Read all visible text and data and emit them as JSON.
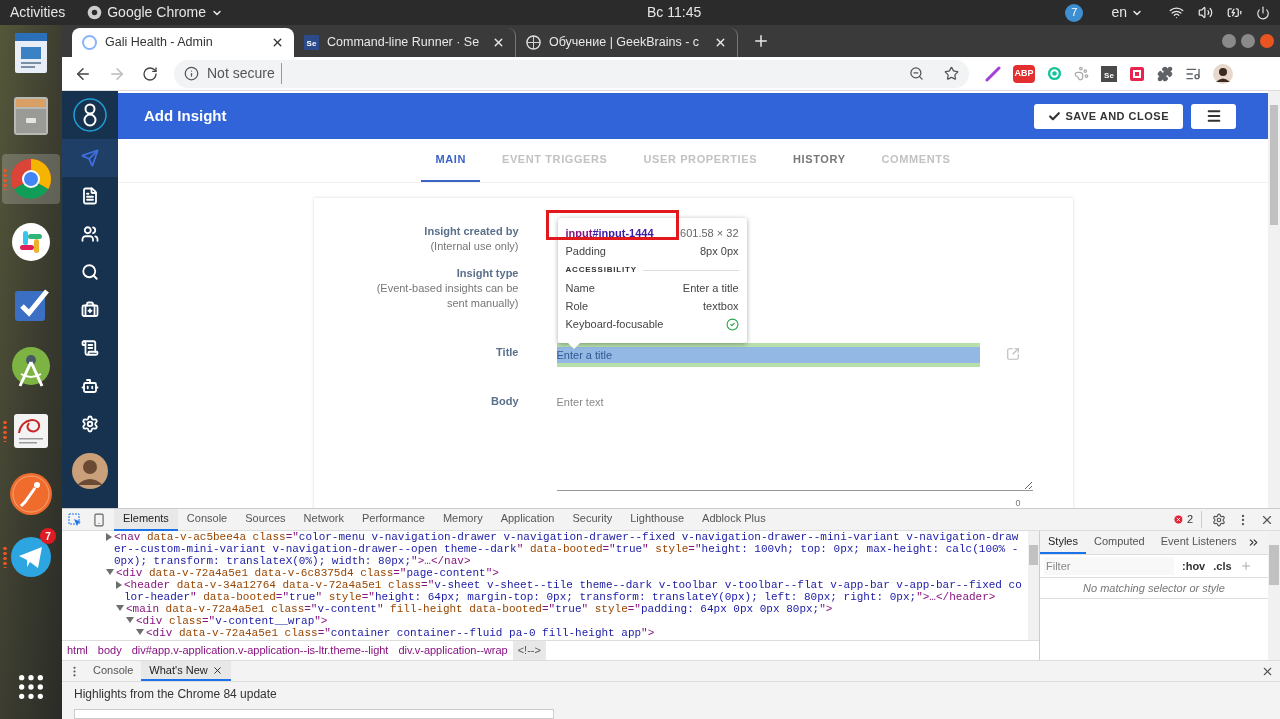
{
  "system_bar": {
    "activities": "Activities",
    "app_menu": "Google Chrome",
    "clock": "Вс 11:45",
    "notification_count": "7",
    "language": "en"
  },
  "dock": [
    {
      "selected": false,
      "running": false
    },
    {
      "selected": false,
      "running": false
    },
    {
      "selected": true,
      "running": true
    },
    {
      "selected": false,
      "running": false
    },
    {
      "selected": false,
      "running": false
    },
    {
      "selected": false,
      "running": false
    },
    {
      "selected": false,
      "running": true
    },
    {
      "selected": false,
      "running": false
    },
    {
      "selected": false,
      "running": true,
      "badge": "7"
    }
  ],
  "browser": {
    "tabs": [
      {
        "title": "Gali Health - Admin",
        "selected": true
      },
      {
        "title": "Command-line Runner · Se",
        "favicon_text": "Se",
        "selected": false
      },
      {
        "title": "Обучение | GeekBrains - c",
        "selected": false
      }
    ],
    "nav_buttons": [
      {
        "kind": "back",
        "disabled": false
      },
      {
        "kind": "forward",
        "disabled": true
      },
      {
        "kind": "reload",
        "disabled": false
      }
    ],
    "security_label": "Not secure",
    "extensions": [
      {
        "kind": "pen"
      },
      {
        "kind": "abp",
        "text": "ABP"
      },
      {
        "kind": "ring"
      },
      {
        "kind": "paw"
      },
      {
        "kind": "tile",
        "text": "Se"
      },
      {
        "kind": "frame"
      },
      {
        "kind": "puzzle"
      },
      {
        "kind": "media"
      },
      {
        "kind": "avatar"
      }
    ]
  },
  "app": {
    "nav": [
      {
        "selected": true
      },
      {
        "selected": false
      },
      {
        "selected": false
      },
      {
        "selected": false
      },
      {
        "selected": false
      },
      {
        "selected": false
      },
      {
        "selected": false
      },
      {
        "selected": false
      }
    ],
    "header": {
      "title": "Add Insight",
      "save_button": "SAVE AND CLOSE"
    },
    "tabs": [
      {
        "label": "MAIN",
        "selected": true,
        "disabled": false
      },
      {
        "label": "EVENT TRIGGERS",
        "selected": false,
        "disabled": true
      },
      {
        "label": "USER PROPERTIES",
        "selected": false,
        "disabled": true
      },
      {
        "label": "HISTORY",
        "selected": false,
        "disabled": false
      },
      {
        "label": "COMMENTS",
        "selected": false,
        "disabled": true
      }
    ],
    "form": [
      {
        "kind": "info",
        "label": "Insight created by",
        "hint": "(Internal use only)"
      },
      {
        "kind": "info",
        "label": "Insight type",
        "hint": "(Event-based insights can be sent manually)"
      },
      {
        "kind": "title",
        "label": "Title",
        "placeholder": "Enter a title"
      },
      {
        "kind": "body",
        "label": "Body",
        "placeholder": "Enter text",
        "counter": "0"
      }
    ],
    "inspect_tooltip": {
      "tag": "input",
      "id": "#input-1444",
      "size": "601.58 × 32",
      "padding_label": "Padding",
      "padding_value": "8px 0px",
      "section": "ACCESSIBILITY",
      "rows": [
        {
          "kind": "text",
          "label": "Name",
          "value": "Enter a title"
        },
        {
          "kind": "text",
          "label": "Role",
          "value": "textbox"
        },
        {
          "kind": "check",
          "label": "Keyboard-focusable"
        }
      ]
    }
  },
  "devtools": {
    "tabs": [
      {
        "label": "Elements",
        "selected": true
      },
      {
        "label": "Console",
        "selected": false
      },
      {
        "label": "Sources",
        "selected": false
      },
      {
        "label": "Network",
        "selected": false
      },
      {
        "label": "Performance",
        "selected": false
      },
      {
        "label": "Memory",
        "selected": false
      },
      {
        "label": "Application",
        "selected": false
      },
      {
        "label": "Security",
        "selected": false
      },
      {
        "label": "Lighthouse",
        "selected": false
      },
      {
        "label": "Adblock Plus",
        "selected": false
      }
    ],
    "error_count": "2",
    "dom": [
      {
        "expanded": false,
        "tokens": [
          {
            "kind": "tag",
            "text": "<nav"
          },
          {
            "kind": "attr",
            "text": " data-v-ac5bee4a class"
          },
          {
            "kind": "punct",
            "text": "=\""
          },
          {
            "kind": "value",
            "text": "color-menu v-navigation-drawer v-navigation-drawer--fixed v-navigation-drawer--mini-variant v-navigation-drawer--custom-mini-variant v-navigation-drawer--open theme--dark"
          },
          {
            "kind": "punct",
            "text": "\""
          },
          {
            "kind": "attr",
            "text": " data-booted"
          },
          {
            "kind": "punct",
            "text": "=\""
          },
          {
            "kind": "value",
            "text": "true"
          },
          {
            "kind": "punct",
            "text": "\""
          },
          {
            "kind": "attr",
            "text": " style"
          },
          {
            "kind": "punct",
            "text": "=\""
          },
          {
            "kind": "value",
            "text": "height: 100vh; top: 0px; max-height: calc(100% - 0px); transform: translateX(0%); width: 80px;"
          },
          {
            "kind": "punct",
            "text": "\">…"
          },
          {
            "kind": "tag",
            "text": "</nav>"
          }
        ]
      },
      {
        "expanded": true,
        "tokens": [
          {
            "kind": "tag",
            "text": "<div"
          },
          {
            "kind": "attr",
            "text": " data-v-72a4a5e1 data-v-6c8375d4 class"
          },
          {
            "kind": "punct",
            "text": "=\""
          },
          {
            "kind": "value",
            "text": "page-content"
          },
          {
            "kind": "punct",
            "text": "\">"
          }
        ],
        "children": [
          {
            "expanded": false,
            "tokens": [
              {
                "kind": "tag",
                "text": "<header"
              },
              {
                "kind": "attr",
                "text": " data-v-34a12764 data-v-72a4a5e1 class"
              },
              {
                "kind": "punct",
                "text": "=\""
              },
              {
                "kind": "value",
                "text": "v-sheet v-sheet--tile theme--dark v-toolbar v-toolbar--flat v-app-bar v-app-bar--fixed color-header"
              },
              {
                "kind": "punct",
                "text": "\""
              },
              {
                "kind": "attr",
                "text": " data-booted"
              },
              {
                "kind": "punct",
                "text": "=\""
              },
              {
                "kind": "value",
                "text": "true"
              },
              {
                "kind": "punct",
                "text": "\""
              },
              {
                "kind": "attr",
                "text": " style"
              },
              {
                "kind": "punct",
                "text": "=\""
              },
              {
                "kind": "value",
                "text": "height: 64px; margin-top: 0px; transform: translateY(0px); left: 80px; right: 0px;"
              },
              {
                "kind": "punct",
                "text": "\">…"
              },
              {
                "kind": "tag",
                "text": "</header>"
              }
            ]
          },
          {
            "expanded": true,
            "tokens": [
              {
                "kind": "tag",
                "text": "<main"
              },
              {
                "kind": "attr",
                "text": " data-v-72a4a5e1 class"
              },
              {
                "kind": "punct",
                "text": "=\""
              },
              {
                "kind": "value",
                "text": "v-content"
              },
              {
                "kind": "punct",
                "text": "\""
              },
              {
                "kind": "attr",
                "text": " fill-height data-booted"
              },
              {
                "kind": "punct",
                "text": "=\""
              },
              {
                "kind": "value",
                "text": "true"
              },
              {
                "kind": "punct",
                "text": "\""
              },
              {
                "kind": "attr",
                "text": " style"
              },
              {
                "kind": "punct",
                "text": "=\""
              },
              {
                "kind": "value",
                "text": "padding: 64px 0px 0px 80px;"
              },
              {
                "kind": "punct",
                "text": "\">"
              }
            ],
            "children": [
              {
                "expanded": true,
                "tokens": [
                  {
                    "kind": "tag",
                    "text": "<div"
                  },
                  {
                    "kind": "attr",
                    "text": " class"
                  },
                  {
                    "kind": "punct",
                    "text": "=\""
                  },
                  {
                    "kind": "value",
                    "text": "v-content__wrap"
                  },
                  {
                    "kind": "punct",
                    "text": "\">"
                  }
                ],
                "children": [
                  {
                    "expanded": true,
                    "tokens": [
                      {
                        "kind": "tag",
                        "text": "<div"
                      },
                      {
                        "kind": "attr",
                        "text": " data-v-72a4a5e1 class"
                      },
                      {
                        "kind": "punct",
                        "text": "=\""
                      },
                      {
                        "kind": "value",
                        "text": "container container--fluid pa-0 fill-height app"
                      },
                      {
                        "kind": "punct",
                        "text": "\">"
                      }
                    ]
                  }
                ]
              }
            ]
          }
        ]
      }
    ],
    "breadcrumbs": [
      {
        "label": "html",
        "selected": false
      },
      {
        "label": "body",
        "selected": false
      },
      {
        "label": "div#app.v-application.v-application--is-ltr.theme--light",
        "selected": false
      },
      {
        "label": "div.v-application--wrap",
        "selected": false
      },
      {
        "label": "<!-->",
        "selected": true
      }
    ],
    "side_tabs": [
      {
        "label": "Styles",
        "selected": true
      },
      {
        "label": "Computed",
        "selected": false
      },
      {
        "label": "Event Listeners",
        "selected": false
      }
    ],
    "filter": {
      "placeholder": "Filter",
      "hov": ":hov",
      "cls": ".cls"
    },
    "empty_message": "No matching selector or style",
    "drawer_tabs": [
      {
        "label": "Console",
        "selected": false,
        "closable": false
      },
      {
        "label": "What's New",
        "selected": true,
        "closable": true
      }
    ],
    "drawer_text": "Highlights from the Chrome 84 update"
  }
}
